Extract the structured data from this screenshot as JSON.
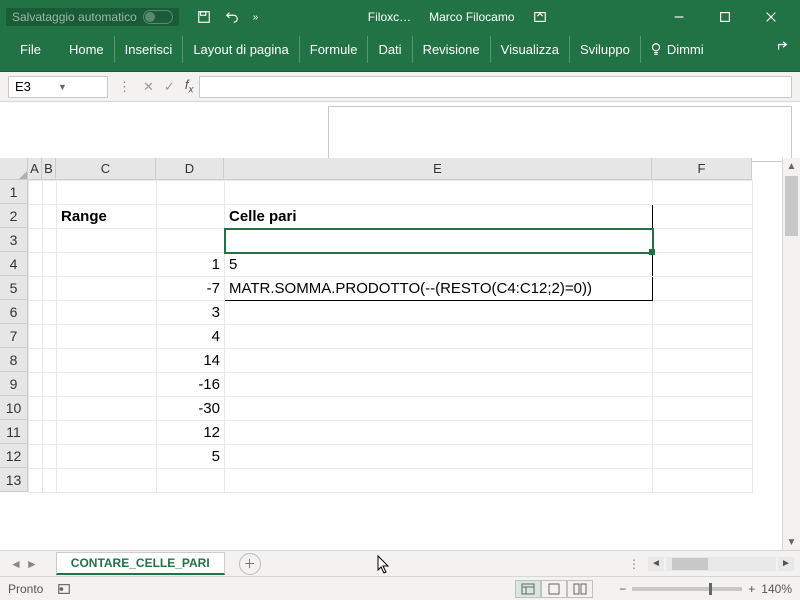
{
  "titlebar": {
    "autosave_label": "Salvataggio automatico",
    "doc_name": "Filoxc…",
    "user_name": "Marco Filocamo"
  },
  "ribbon": {
    "tabs": [
      "File",
      "Home",
      "Inserisci",
      "Layout di pagina",
      "Formule",
      "Dati",
      "Revisione",
      "Visualizza",
      "Sviluppo"
    ],
    "tellme": "Dimmi"
  },
  "namebox": "E3",
  "cols": {
    "A": "A",
    "B": "B",
    "C": "C",
    "D": "D",
    "E": "E",
    "F": "F"
  },
  "rows": [
    "1",
    "2",
    "3",
    "4",
    "5",
    "6",
    "7",
    "8",
    "9",
    "10",
    "11",
    "12",
    "13"
  ],
  "cells": {
    "C2": "Range",
    "E2": "Celle pari",
    "D4": "1",
    "D5": "-7",
    "D6": "3",
    "D7": "4",
    "D8": "14",
    "D9": "-16",
    "D10": "-30",
    "D11": "12",
    "D12": "5",
    "E4": "5",
    "E5": "MATR.SOMMA.PRODOTTO(--(RESTO(C4:C12;2)=0))"
  },
  "sheet": {
    "name": "CONTARE_CELLE_PARI"
  },
  "status": {
    "ready": "Pronto",
    "zoom": "140%"
  }
}
